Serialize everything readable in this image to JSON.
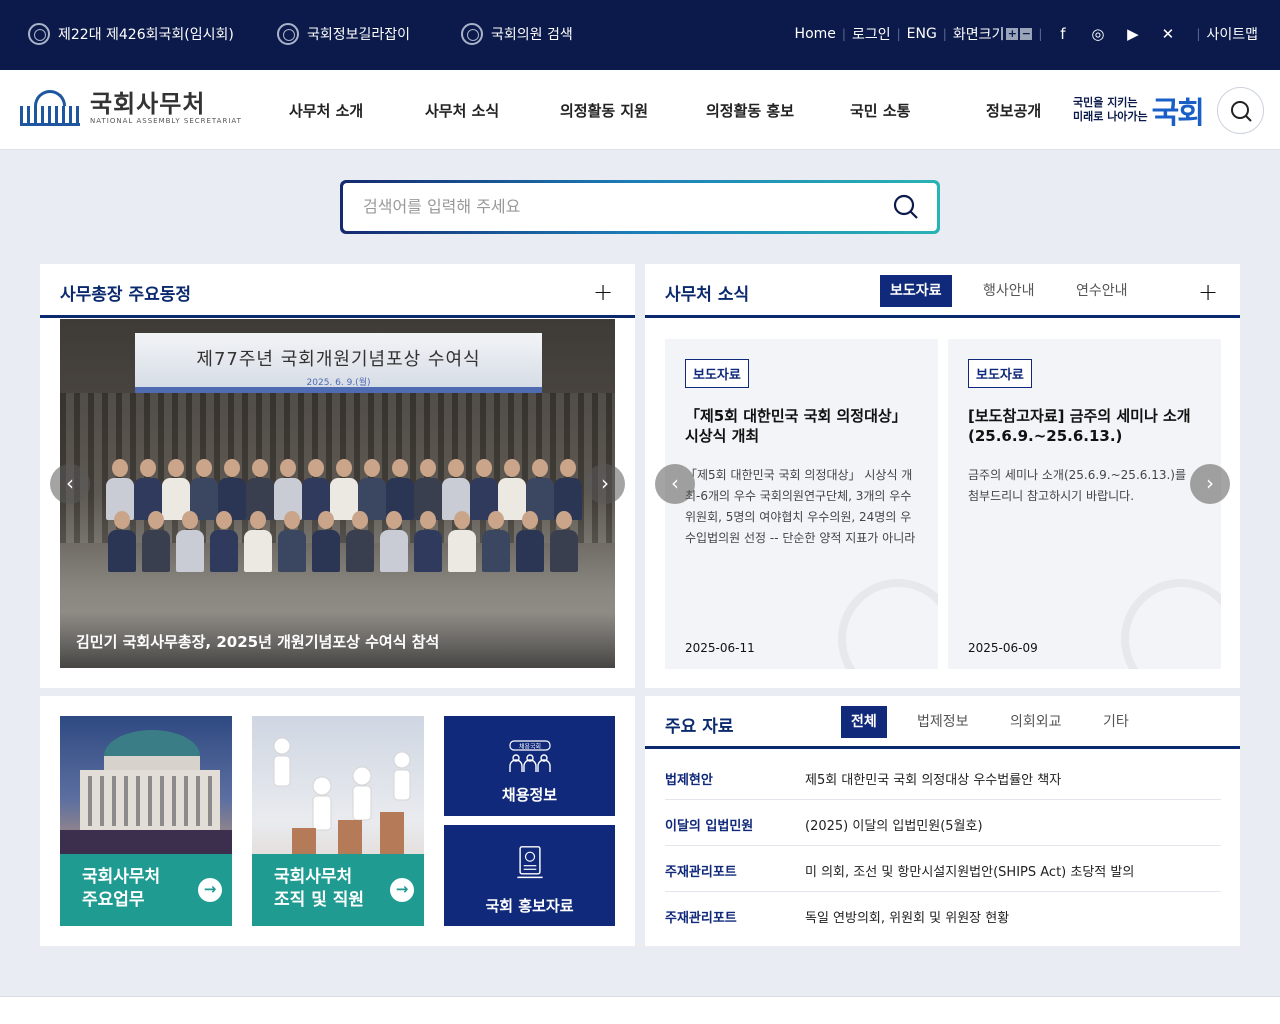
{
  "topbar": {
    "session": "제22대 제426회국회(임시회)",
    "info_guide": "국회정보길라잡이",
    "member_search": "국회의원 검색",
    "home": "Home",
    "login": "로그인",
    "eng": "ENG",
    "screen_size": "화면크기",
    "sitemap": "사이트맵"
  },
  "header": {
    "logo_kr": "국회사무처",
    "logo_en": "NATIONAL ASSEMBLY SECRETARIAT",
    "gnb": [
      "사무처 소개",
      "사무처 소식",
      "의정활동 지원",
      "의정활동 홍보",
      "국민 소통",
      "정보공개"
    ],
    "slogan_line1": "국민을 지키는",
    "slogan_line2": "미래로 나아가는",
    "slogan_big": "국회"
  },
  "search": {
    "placeholder": "검색어를 입력해 주세요"
  },
  "activities": {
    "title": "사무총장 주요동정",
    "photo_banner_title": "제77주년 국회개원기념포상 수여식",
    "photo_banner_date": "2025. 6. 9.(월)",
    "caption": "김민기 국회사무총장, 2025년 개원기념포상 수여식 참석"
  },
  "news": {
    "title": "사무처 소식",
    "tabs": [
      "보도자료",
      "행사안내",
      "연수안내"
    ],
    "cards": [
      {
        "tag": "보도자료",
        "title": "「제5회 대한민국 국회 의정대상」 시상식 개최",
        "desc": "「제5회 대한민국 국회 의정대상」 시상식 개최-6개의 우수 국회의원연구단체, 3개의 우수위원회, 5명의 여야협치 우수의원, 24명의 우수입법의원 선정 -- 단순한 양적 지표가 아니라 정...",
        "date": "2025-06-11"
      },
      {
        "tag": "보도자료",
        "title": "[보도참고자료] 금주의 세미나 소개 (25.6.9.~25.6.13.)",
        "desc": "금주의 세미나 소개(25.6.9.~25.6.13.)를 첨부드리니 참고하시기 바랍니다.",
        "date": "2025-06-09"
      }
    ]
  },
  "tiles": {
    "main_work": [
      "국회사무처",
      "주요업무"
    ],
    "org": [
      "국회사무처",
      "조직 및 직원"
    ],
    "recruit": "채용정보",
    "recruit_badge": "채용국회",
    "pr": "국회 홍보자료"
  },
  "docs": {
    "title": "주요 자료",
    "tabs": [
      "전체",
      "법제정보",
      "의회외교",
      "기타"
    ],
    "rows": [
      {
        "cat": "법제현안",
        "title": "제5회 대한민국 국회 의정대상 우수법률안 책자"
      },
      {
        "cat": "이달의 입법민원",
        "title": "(2025) 이달의 입법민원(5월호)"
      },
      {
        "cat": "주재관리포트",
        "title": "미 의회, 조선 및 항만시설지원법안(SHIPS Act) 초당적 발의"
      },
      {
        "cat": "주재관리포트",
        "title": "독일 연방의회, 위원회 및 위원장 현황"
      }
    ]
  },
  "colors": {
    "topbar": "#0b1a4a",
    "navy": "#10297a",
    "teal": "#1f9b91",
    "brand_blue": "#1a5fc8"
  }
}
